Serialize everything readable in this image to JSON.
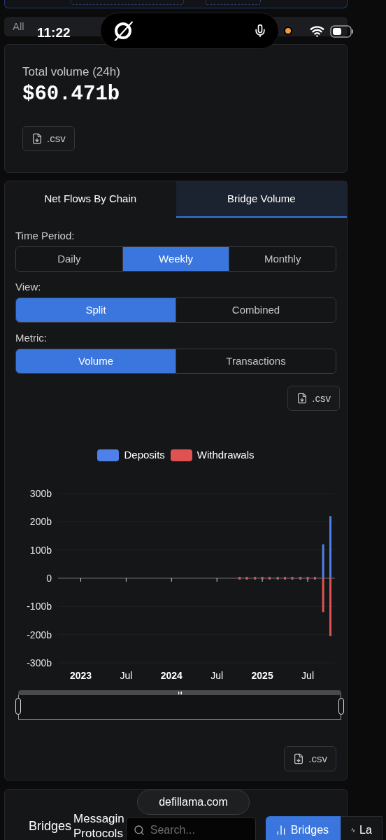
{
  "status_bar": {
    "time": "11:22"
  },
  "filter_bar": {
    "label": "All"
  },
  "summary": {
    "label": "Total volume (24h)",
    "value": "$60.471b",
    "csv_button": ".csv"
  },
  "tabs": [
    {
      "label": "Net Flows By Chain",
      "selected": false
    },
    {
      "label": "Bridge Volume",
      "selected": true
    }
  ],
  "controls": [
    {
      "label": "Time Period:",
      "options": [
        {
          "label": "Daily",
          "selected": false
        },
        {
          "label": "Weekly",
          "selected": true
        },
        {
          "label": "Monthly",
          "selected": false
        }
      ]
    },
    {
      "label": "View:",
      "options": [
        {
          "label": "Split",
          "selected": true
        },
        {
          "label": "Combined",
          "selected": false
        }
      ]
    },
    {
      "label": "Metric:",
      "options": [
        {
          "label": "Volume",
          "selected": true
        },
        {
          "label": "Transactions",
          "selected": false
        }
      ]
    }
  ],
  "chart_csv_button": ".csv",
  "chart": {
    "chart_data": {
      "type": "bar",
      "x": [
        2022.75,
        2022.83,
        2022.92,
        2023,
        2023.08,
        2023.17,
        2023.25,
        2023.33,
        2023.42,
        2023.5,
        2023.58,
        2023.67,
        2023.75,
        2023.83,
        2023.92,
        2024,
        2024.08,
        2024.17,
        2024.25,
        2024.33,
        2024.42,
        2024.5,
        2024.58,
        2024.67,
        2024.75,
        2024.83,
        2024.92,
        2025,
        2025.08,
        2025.17,
        2025.25,
        2025.33,
        2025.42,
        2025.5,
        2025.58,
        2025.67,
        2025.75
      ],
      "series": [
        {
          "name": "Deposits",
          "color": "#4f7fe8",
          "values": [
            0,
            0,
            0,
            0,
            0,
            0,
            0,
            0,
            0,
            0,
            0,
            0,
            0,
            0,
            0,
            0,
            0,
            0,
            0,
            0,
            0,
            0,
            0,
            0,
            5,
            5,
            5,
            5,
            5,
            5,
            5,
            5,
            5,
            5,
            5,
            120,
            220
          ]
        },
        {
          "name": "Withdrawals",
          "color": "#e05252",
          "values": [
            0,
            0,
            0,
            0,
            0,
            0,
            0,
            0,
            0,
            0,
            0,
            0,
            0,
            0,
            0,
            0,
            0,
            0,
            0,
            0,
            0,
            0,
            0,
            0,
            -5,
            -5,
            -5,
            -5,
            -5,
            -5,
            -5,
            -5,
            -5,
            -5,
            -5,
            -120,
            -205
          ]
        }
      ],
      "stacked": true,
      "grid": true,
      "xlim": [
        2022.75,
        2025.8
      ],
      "ylim": [
        -300,
        300
      ],
      "yticks": [
        {
          "value": 300,
          "label": "300b"
        },
        {
          "value": 200,
          "label": "200b"
        },
        {
          "value": 100,
          "label": "100b"
        },
        {
          "value": 0,
          "label": "0"
        },
        {
          "value": -100,
          "label": "-100b"
        },
        {
          "value": -200,
          "label": "-200b"
        },
        {
          "value": -300,
          "label": "-300b"
        }
      ],
      "xticks": [
        {
          "value": 2023,
          "label": "2023"
        },
        {
          "value": 2023.5,
          "label": "Jul"
        },
        {
          "value": 2024,
          "label": "2024"
        },
        {
          "value": 2024.5,
          "label": "Jul"
        },
        {
          "value": 2025,
          "label": "2025"
        },
        {
          "value": 2025.5,
          "label": "Jul"
        }
      ]
    }
  },
  "range_slider": {
    "level": 1
  },
  "bottom_csv_button": ".csv",
  "bottom_bar": {
    "title": "Bridges",
    "subtitle_lines": [
      "Messagin",
      "Protocols"
    ],
    "search": {
      "placeholder": "Search..."
    },
    "tabs": [
      {
        "label": "Bridges",
        "kind": "bars",
        "selected": true
      },
      {
        "label": "La",
        "kind": "pulse",
        "selected": false
      }
    ]
  },
  "url_pill": {
    "label": "defillama.com"
  }
}
